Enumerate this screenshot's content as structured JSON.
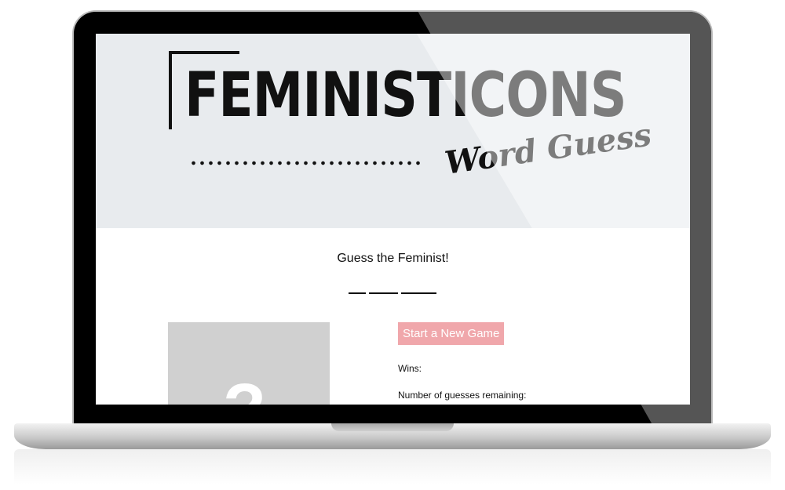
{
  "header": {
    "logo_text": "FEMINISTICONS",
    "logo_subtitle": "Word Guess"
  },
  "game": {
    "title": "Guess the Feminist!",
    "blank_count": 3,
    "portrait_symbol": "?",
    "start_button_label": "Start a New Game",
    "wins_label": "Wins:",
    "guesses_label": "Number of guesses remaining:"
  },
  "colors": {
    "hero_background": "#e8ebee",
    "start_button": "#f0a7ab",
    "portrait_placeholder": "#d0d0d0",
    "laptop_bezel": "#000000"
  }
}
